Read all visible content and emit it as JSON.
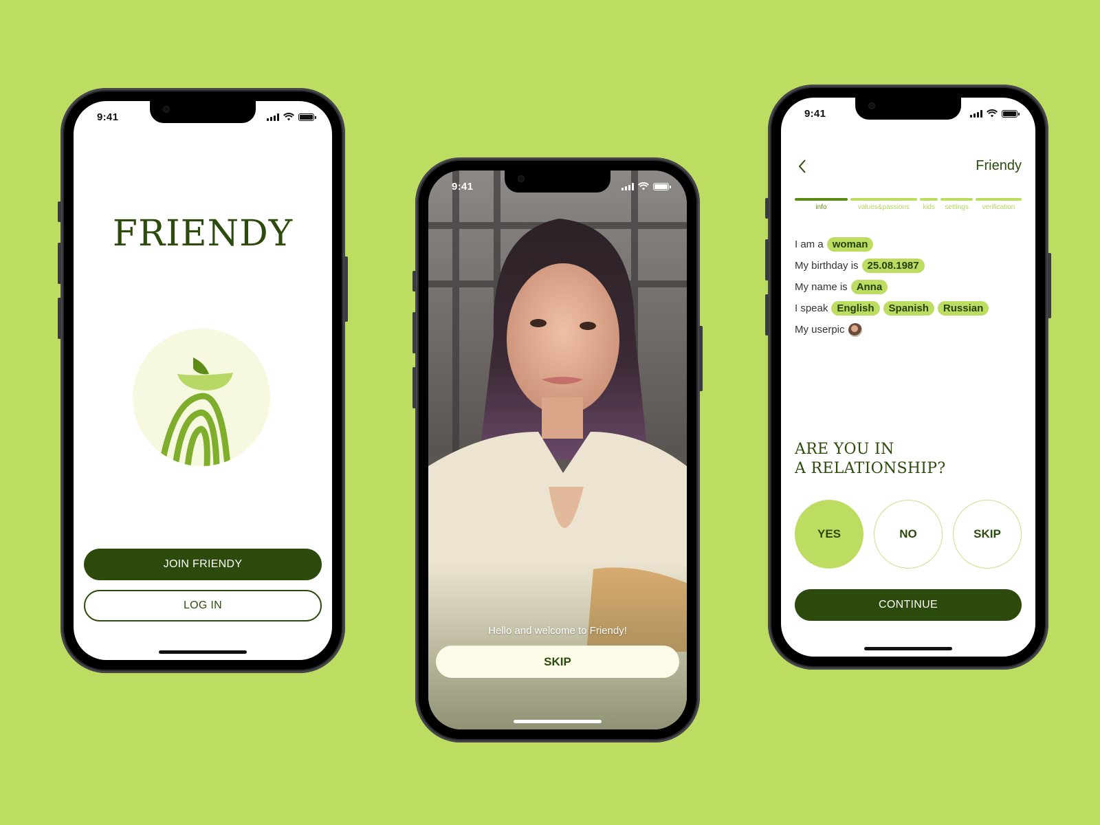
{
  "colors": {
    "background": "#bddc62",
    "brand_dark": "#2b4a0b",
    "brand_light": "#bddc62",
    "brand_mid": "#5d8b17",
    "cream": "#fbfbe8"
  },
  "status_bar": {
    "time": "9:41",
    "icons": [
      "signal-icon",
      "wifi-icon",
      "battery-icon"
    ]
  },
  "phone1": {
    "brand_title": "FRIENDY",
    "logo": "friendy-logo",
    "join_label": "JOIN FRIENDY",
    "login_label": "LOG IN"
  },
  "phone2": {
    "welcome_text": "Hello and welcome to Friendy!",
    "skip_label": "SKIP"
  },
  "phone3": {
    "nav_title": "Friendy",
    "back_icon": "chevron-left-icon",
    "steps": [
      {
        "label": "info",
        "active": true
      },
      {
        "label": "values&passions",
        "active": false
      },
      {
        "label": "kids",
        "active": false
      },
      {
        "label": "settings",
        "active": false
      },
      {
        "label": "verification",
        "active": false
      }
    ],
    "info": {
      "gender_prefix": "I am a",
      "gender": "woman",
      "birthday_prefix": "My birthday is",
      "birthday": "25.08.1987",
      "name_prefix": "My name is",
      "name": "Anna",
      "languages_prefix": "I speak",
      "languages": [
        "English",
        "Spanish",
        "Russian"
      ],
      "userpic_prefix": "My userpic"
    },
    "question_line1": "ARE YOU IN",
    "question_line2": "A RELATIONSHIP?",
    "answers": [
      {
        "label": "YES",
        "selected": true
      },
      {
        "label": "NO",
        "selected": false
      },
      {
        "label": "SKIP",
        "selected": false
      }
    ],
    "continue_label": "CONTINUE"
  }
}
